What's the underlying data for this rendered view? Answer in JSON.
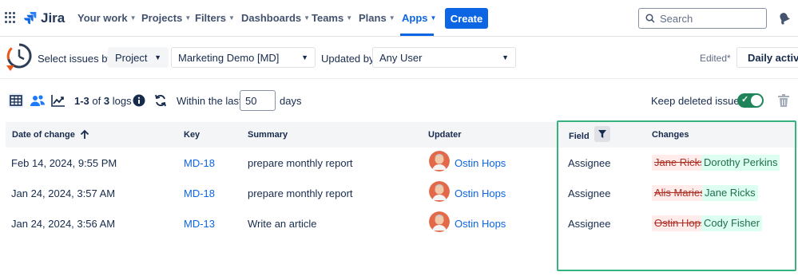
{
  "nav": {
    "app_name": "Jira",
    "items": [
      {
        "label": "Your work"
      },
      {
        "label": "Projects"
      },
      {
        "label": "Filters"
      },
      {
        "label": "Dashboards"
      },
      {
        "label": "Teams"
      },
      {
        "label": "Plans"
      },
      {
        "label": "Apps",
        "active": true
      }
    ],
    "create_label": "Create",
    "search_placeholder": "Search"
  },
  "filterbar": {
    "select_issues_label": "Select issues by:",
    "select_issues_value": "Project",
    "project_value": "Marketing Demo [MD]",
    "updated_by_label": "Updated by:",
    "updated_by_value": "Any User",
    "edited_label": "Edited*",
    "view_label": "Daily activity"
  },
  "toolbar": {
    "range": "1-3",
    "of_label": "of",
    "total": "3",
    "logs_label": "logs",
    "within_label": "Within the last:",
    "days_value": "50",
    "days_label": "days",
    "keep_deleted_label": "Keep deleted issues",
    "keep_deleted_on": true
  },
  "table": {
    "columns": [
      "Date of change",
      "Key",
      "Summary",
      "Updater",
      "Field",
      "Changes"
    ],
    "rows": [
      {
        "date": "Feb 14, 2024, 9:55 PM",
        "key": "MD-18",
        "summary": "prepare monthly report",
        "updater": "Ostin Hops",
        "field": "Assignee",
        "old": "Jane Ricks",
        "new": "Dorothy Perkins"
      },
      {
        "date": "Jan 24, 2024, 3:57 AM",
        "key": "MD-18",
        "summary": "prepare monthly report",
        "updater": "Ostin Hops",
        "field": "Assignee",
        "old": "Alis Maries",
        "new": "Jane Ricks"
      },
      {
        "date": "Jan 24, 2024, 3:56 AM",
        "key": "MD-13",
        "summary": "Write an article",
        "updater": "Ostin Hops",
        "field": "Assignee",
        "old": "Ostin Hops",
        "new": "Cody Fisher"
      }
    ]
  },
  "colors": {
    "accent": "#0c66e4",
    "removed_bg": "#ffeceb",
    "removed_text": "#ae2e24",
    "added_bg": "#dcfff1",
    "added_text": "#216e4e",
    "highlight_box": "#36b37e",
    "toggle_on": "#1f845a"
  }
}
